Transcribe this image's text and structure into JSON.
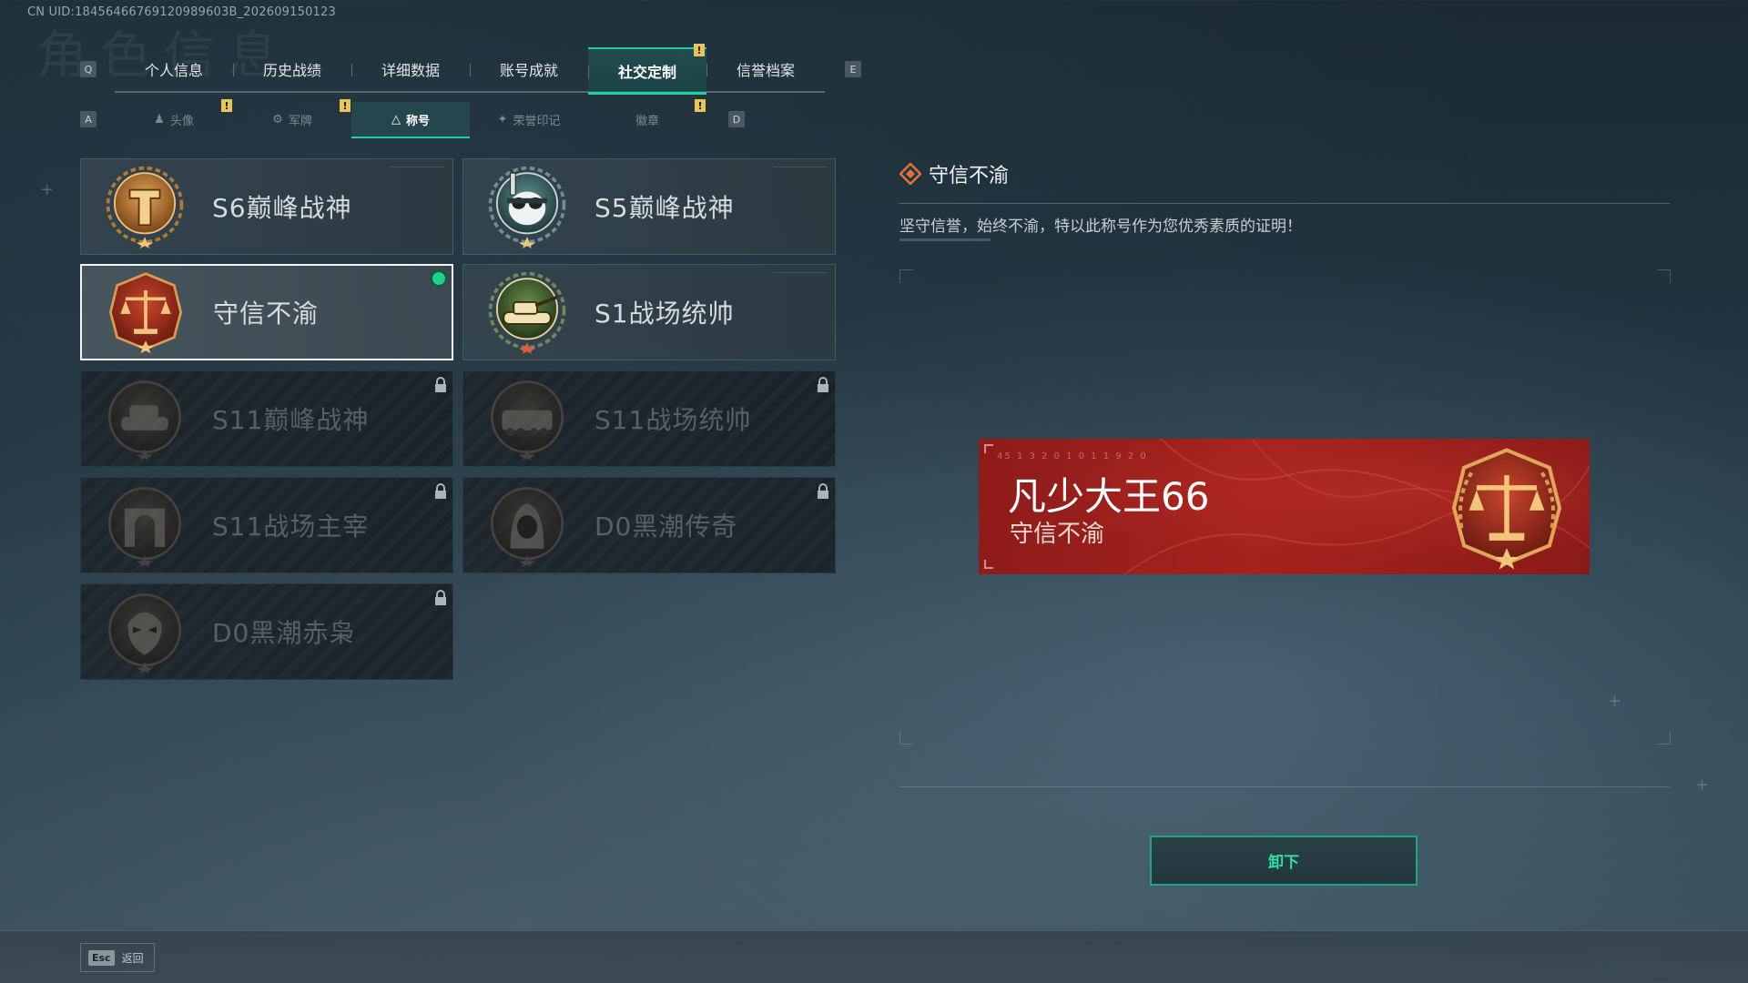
{
  "uid_text": "CN UID:18456466769120989603B_202609150123",
  "ghost_title": "角色信息",
  "main_tabs": {
    "left_key": "Q",
    "right_key": "E",
    "items": [
      {
        "label": "个人信息"
      },
      {
        "label": "历史战绩"
      },
      {
        "label": "详细数据"
      },
      {
        "label": "账号成就"
      },
      {
        "label": "社交定制"
      },
      {
        "label": "信誉档案"
      }
    ],
    "active_index": 4
  },
  "sub_tabs": {
    "left_key": "A",
    "right_key": "D",
    "items": [
      {
        "label": "头像",
        "icon": "person-icon"
      },
      {
        "label": "军牌",
        "icon": "dogtag-icon"
      },
      {
        "label": "称号",
        "icon": "title-icon"
      },
      {
        "label": "荣誉印记",
        "icon": "honor-icon"
      },
      {
        "label": "徽章",
        "icon": ""
      }
    ],
    "active_index": 2
  },
  "warning_glyph": "!",
  "titles": [
    {
      "label": "S6巅峰战神",
      "locked": false,
      "emblem": "s6-emblem"
    },
    {
      "label": "S5巅峰战神",
      "locked": false,
      "emblem": "s5-emblem"
    },
    {
      "label": "守信不渝",
      "locked": false,
      "selected": true,
      "equipped": true,
      "emblem": "scales-emblem"
    },
    {
      "label": "S1战场统帅",
      "locked": false,
      "emblem": "tank-emblem"
    },
    {
      "label": "S11巅峰战神",
      "locked": true,
      "emblem": "s11-tank-emblem"
    },
    {
      "label": "S11战场统帅",
      "locked": true,
      "emblem": "s11-apc-emblem"
    },
    {
      "label": "S11战场主宰",
      "locked": true,
      "emblem": "arch-emblem"
    },
    {
      "label": "D0黑潮传奇",
      "locked": true,
      "emblem": "hood-emblem"
    },
    {
      "label": "D0黑潮赤枭",
      "locked": true,
      "emblem": "mask-emblem"
    }
  ],
  "detail": {
    "title": "守信不渝",
    "description": "坚守信誉，始终不渝，特以此称号作为您优秀素质的证明！"
  },
  "preview": {
    "player_name": "凡少大王66",
    "title": "守信不渝",
    "code": "45 1 3 2 0 1   0 1 1 9 2 0"
  },
  "action_button": {
    "label": "卸下"
  },
  "footer": {
    "esc_key": "Esc",
    "back_label": "返回"
  },
  "colors": {
    "accent": "#1ed2a0",
    "warning": "#e8c45a",
    "banner_red": "#a5221e",
    "bronze": "#c8873a"
  }
}
